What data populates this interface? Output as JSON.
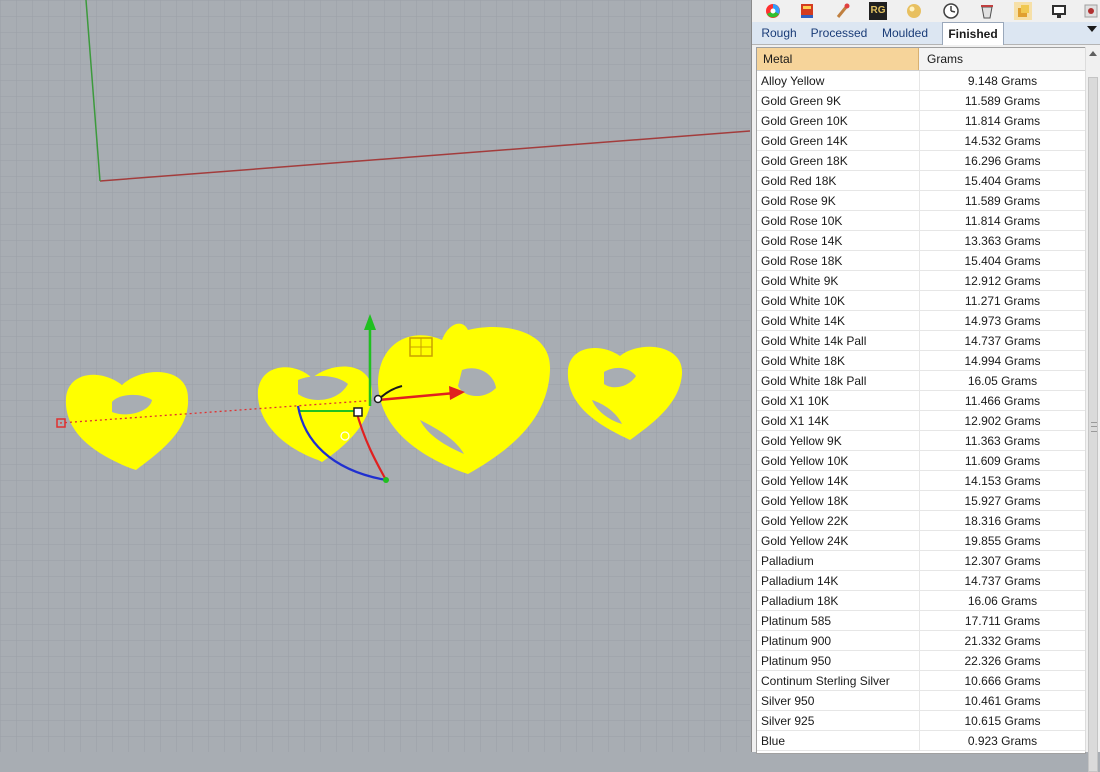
{
  "tabs": [
    {
      "label": "Rough"
    },
    {
      "label": "Processed"
    },
    {
      "label": "Moulded"
    },
    {
      "label": "Finished"
    }
  ],
  "active_tab": "Finished",
  "toolbar_icons": [
    "color-wheel-icon",
    "book-icon",
    "brush-icon",
    "rg-logo-icon",
    "material-sphere-icon",
    "clock-icon",
    "bucket-icon",
    "layers-icon",
    "monitor-icon",
    "more-icon"
  ],
  "rg_label": "RG",
  "table": {
    "columns": {
      "metal": "Metal",
      "grams": "Grams"
    },
    "rows": [
      {
        "metal": "Alloy Yellow",
        "grams": "9.148 Grams"
      },
      {
        "metal": "Gold Green 9K",
        "grams": "11.589 Grams"
      },
      {
        "metal": "Gold Green 10K",
        "grams": "11.814 Grams"
      },
      {
        "metal": "Gold Green 14K",
        "grams": "14.532 Grams"
      },
      {
        "metal": "Gold Green 18K",
        "grams": "16.296 Grams"
      },
      {
        "metal": "Gold Red 18K",
        "grams": "15.404 Grams"
      },
      {
        "metal": "Gold Rose 9K",
        "grams": "11.589 Grams"
      },
      {
        "metal": "Gold Rose 10K",
        "grams": "11.814 Grams"
      },
      {
        "metal": "Gold Rose 14K",
        "grams": "13.363 Grams"
      },
      {
        "metal": "Gold Rose 18K",
        "grams": "15.404 Grams"
      },
      {
        "metal": "Gold White 9K",
        "grams": "12.912 Grams"
      },
      {
        "metal": "Gold White 10K",
        "grams": "11.271 Grams"
      },
      {
        "metal": "Gold White 14K",
        "grams": "14.973 Grams"
      },
      {
        "metal": "Gold White 14k Pall",
        "grams": "14.737 Grams"
      },
      {
        "metal": "Gold White 18K",
        "grams": "14.994 Grams"
      },
      {
        "metal": "Gold White 18k Pall",
        "grams": "16.05 Grams"
      },
      {
        "metal": "Gold X1 10K",
        "grams": "11.466 Grams"
      },
      {
        "metal": "Gold X1 14K",
        "grams": "12.902 Grams"
      },
      {
        "metal": "Gold Yellow 9K",
        "grams": "11.363 Grams"
      },
      {
        "metal": "Gold Yellow 10K",
        "grams": "11.609 Grams"
      },
      {
        "metal": "Gold Yellow 14K",
        "grams": "14.153 Grams"
      },
      {
        "metal": "Gold Yellow 18K",
        "grams": "15.927 Grams"
      },
      {
        "metal": "Gold Yellow 22K",
        "grams": "18.316 Grams"
      },
      {
        "metal": "Gold Yellow 24K",
        "grams": "19.855 Grams"
      },
      {
        "metal": "Palladium",
        "grams": "12.307 Grams"
      },
      {
        "metal": "Palladium 14K",
        "grams": "14.737 Grams"
      },
      {
        "metal": "Palladium 18K",
        "grams": "16.06 Grams"
      },
      {
        "metal": "Platinum 585",
        "grams": "17.711 Grams"
      },
      {
        "metal": "Platinum 900",
        "grams": "21.332 Grams"
      },
      {
        "metal": "Platinum 950",
        "grams": "22.326 Grams"
      },
      {
        "metal": "Continum Sterling Silver",
        "grams": "10.666 Grams"
      },
      {
        "metal": "Silver 950",
        "grams": "10.461 Grams"
      },
      {
        "metal": "Silver 925",
        "grams": "10.615 Grams"
      },
      {
        "metal": "Blue",
        "grams": "0.923 Grams"
      }
    ]
  },
  "colors": {
    "viewport_bg": "#a8adb3",
    "grid_line": "#9aa0a7",
    "object_yellow": "#ffff00",
    "x_axis": "#a33c3c",
    "y_axis": "#3c9a3c",
    "header_highlight": "#f6d49a"
  }
}
